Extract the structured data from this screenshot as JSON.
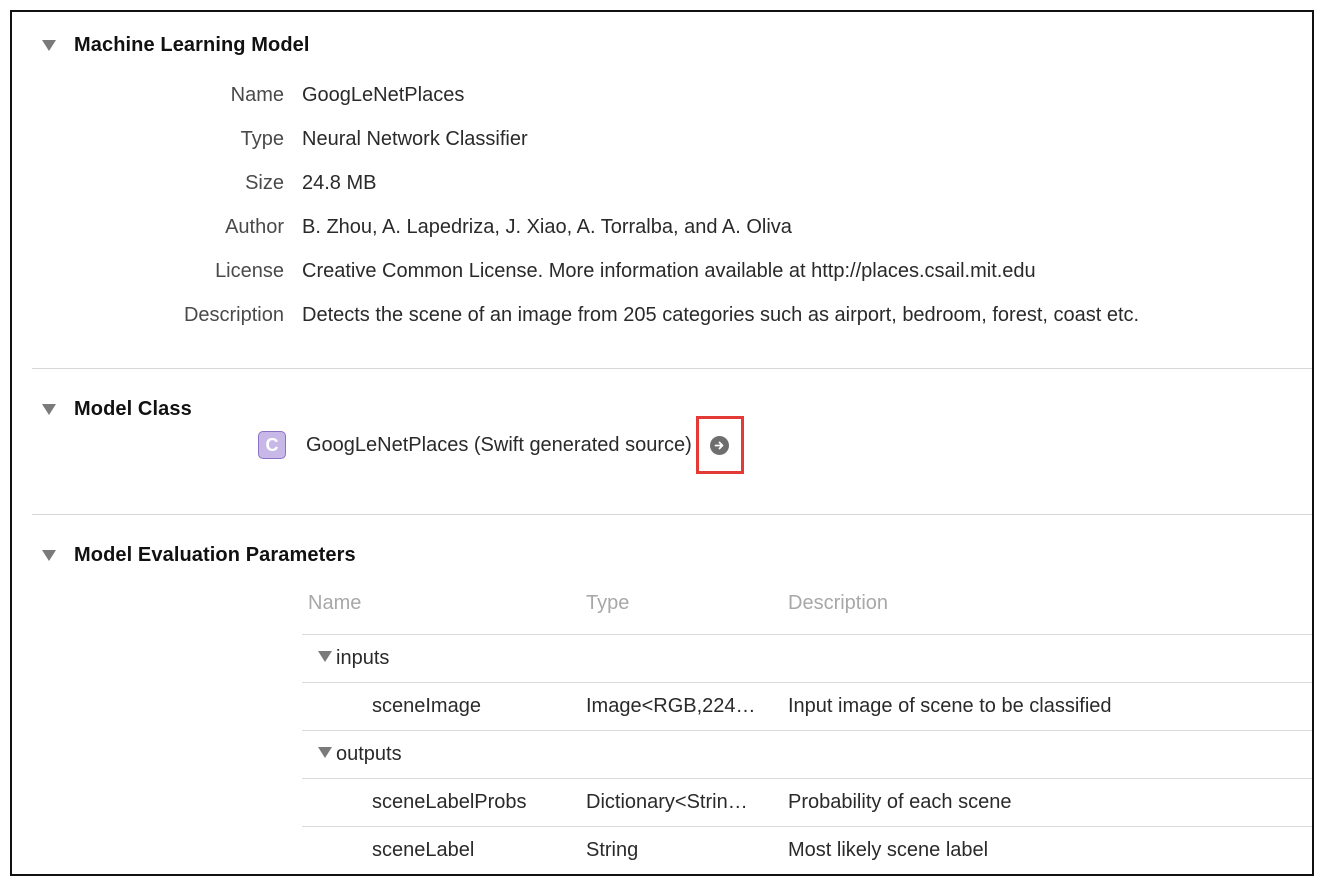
{
  "sections": {
    "ml_model": {
      "title": "Machine Learning Model",
      "fields": [
        {
          "label": "Name",
          "value": "GoogLeNetPlaces"
        },
        {
          "label": "Type",
          "value": "Neural Network Classifier"
        },
        {
          "label": "Size",
          "value": "24.8 MB"
        },
        {
          "label": "Author",
          "value": "B. Zhou, A. Lapedriza, J. Xiao, A. Torralba, and A. Oliva"
        },
        {
          "label": "License",
          "value": "Creative Common License. More information available at http://places.csail.mit.edu"
        },
        {
          "label": "Description",
          "value": "Detects the scene of an image from 205 categories such as airport, bedroom, forest, coast etc."
        }
      ]
    },
    "model_class": {
      "title": "Model Class",
      "class_icon_letter": "C",
      "class_name": "GoogLeNetPlaces (Swift generated source)",
      "jump_icon": "arrow-circle-right-icon",
      "highlight_color": "#e43a35"
    },
    "evaluation": {
      "title": "Model Evaluation Parameters",
      "columns": [
        "Name",
        "Type",
        "Description"
      ],
      "rows": [
        {
          "kind": "group",
          "name": "inputs"
        },
        {
          "kind": "param",
          "name": "sceneImage",
          "type": "Image<RGB,224…",
          "description": "Input image of scene to be classified"
        },
        {
          "kind": "group",
          "name": "outputs"
        },
        {
          "kind": "param",
          "name": "sceneLabelProbs",
          "type": "Dictionary<Strin…",
          "description": "Probability of each scene"
        },
        {
          "kind": "param",
          "name": "sceneLabel",
          "type": "String",
          "description": "Most likely scene label"
        }
      ]
    }
  }
}
